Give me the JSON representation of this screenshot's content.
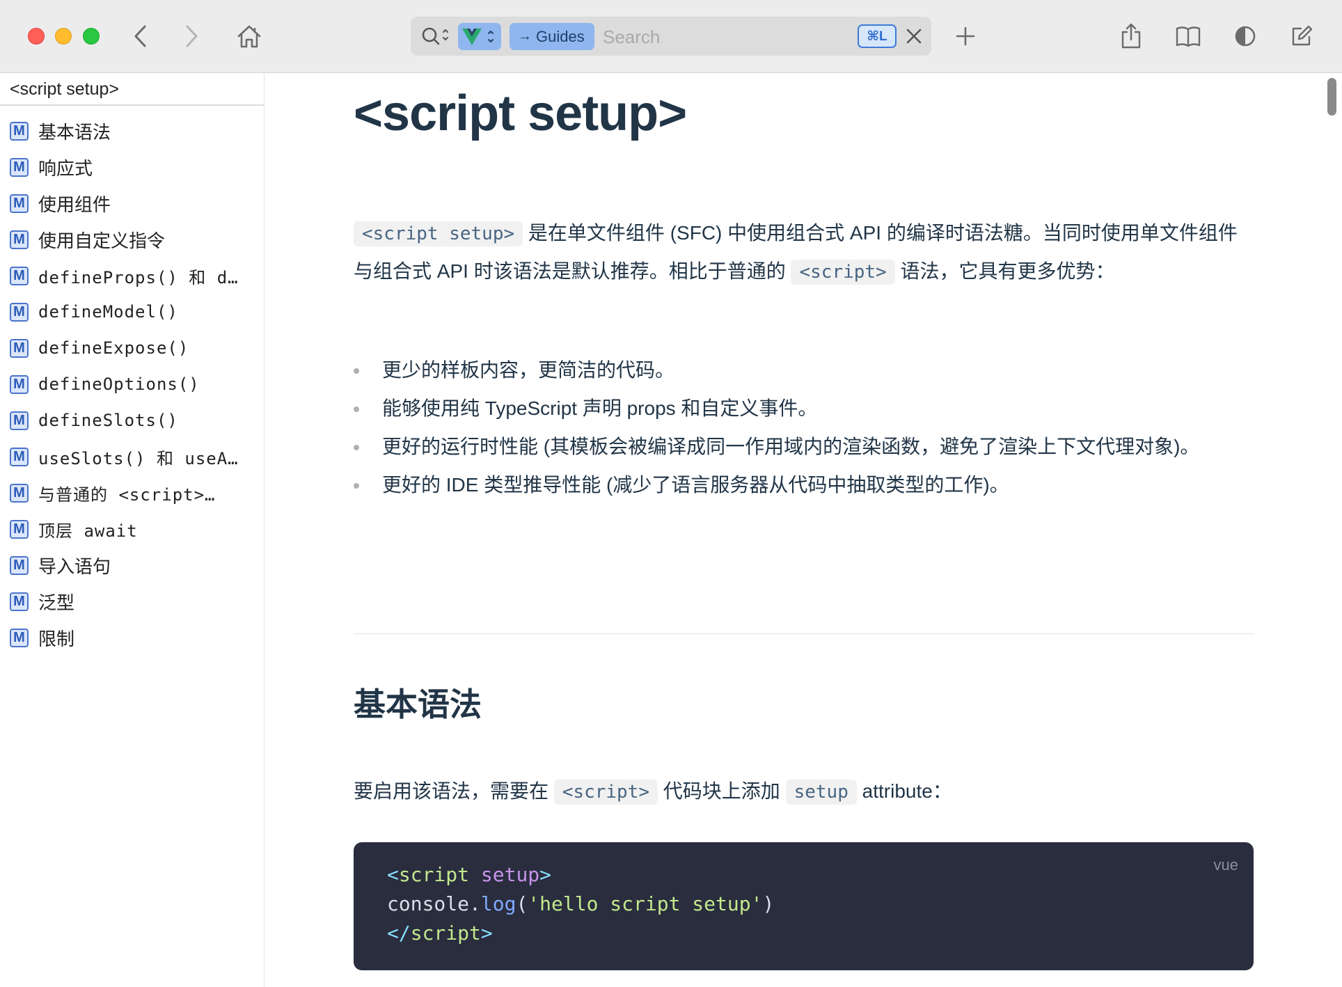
{
  "toolbar": {
    "address_pill": "Guides",
    "placeholder": "Search",
    "shortcut": "⌘L"
  },
  "sidebar": {
    "header": "<script setup>",
    "items": [
      {
        "badge": "M",
        "label": "基本语法"
      },
      {
        "badge": "M",
        "label": "响应式"
      },
      {
        "badge": "M",
        "label": "使用组件"
      },
      {
        "badge": "M",
        "label": "使用自定义指令"
      },
      {
        "badge": "M",
        "label": "defineProps() 和 d…"
      },
      {
        "badge": "M",
        "label": "defineModel()"
      },
      {
        "badge": "M",
        "label": "defineExpose()"
      },
      {
        "badge": "M",
        "label": "defineOptions()"
      },
      {
        "badge": "M",
        "label": "defineSlots()"
      },
      {
        "badge": "M",
        "label": "useSlots() 和 useA…"
      },
      {
        "badge": "M",
        "label": "与普通的 <script>…"
      },
      {
        "badge": "M",
        "label": "顶层 await"
      },
      {
        "badge": "M",
        "label": "导入语句"
      },
      {
        "badge": "M",
        "label": "泛型"
      },
      {
        "badge": "M",
        "label": "限制"
      }
    ]
  },
  "main": {
    "title": "<script setup>",
    "intro": {
      "code1": "<script setup>",
      "text1": " 是在单文件组件 (SFC) 中使用组合式 API 的编译时语法糖。当同时使用单文件组件与组合式 API 时该语法是默认推荐。相比于普通的 ",
      "code2": "<script>",
      "text2": " 语法，它具有更多优势："
    },
    "bullets": [
      "更少的样板内容，更简洁的代码。",
      "能够使用纯 TypeScript 声明 props 和自定义事件。",
      "更好的运行时性能 (其模板会被编译成同一作用域内的渲染函数，避免了渲染上下文代理对象)。",
      "更好的 IDE 类型推导性能 (减少了语言服务器从代码中抽取类型的工作)。"
    ],
    "section_title": "基本语法",
    "section_text": {
      "text1": "要启用该语法，需要在 ",
      "code1": "<script>",
      "text2": " 代码块上添加 ",
      "code2": "setup",
      "text3": " attribute："
    },
    "code": {
      "lang": "vue",
      "line1_open": "<",
      "line1_tag": "script",
      "line1_attr": " setup",
      "line1_close": ">",
      "line2_obj": "console.",
      "line2_fn": "log",
      "line2_paren_open": "(",
      "line2_str": "'hello script setup'",
      "line2_paren_close": ")",
      "line3_open": "</",
      "line3_tag": "script",
      "line3_close": ">"
    }
  }
}
